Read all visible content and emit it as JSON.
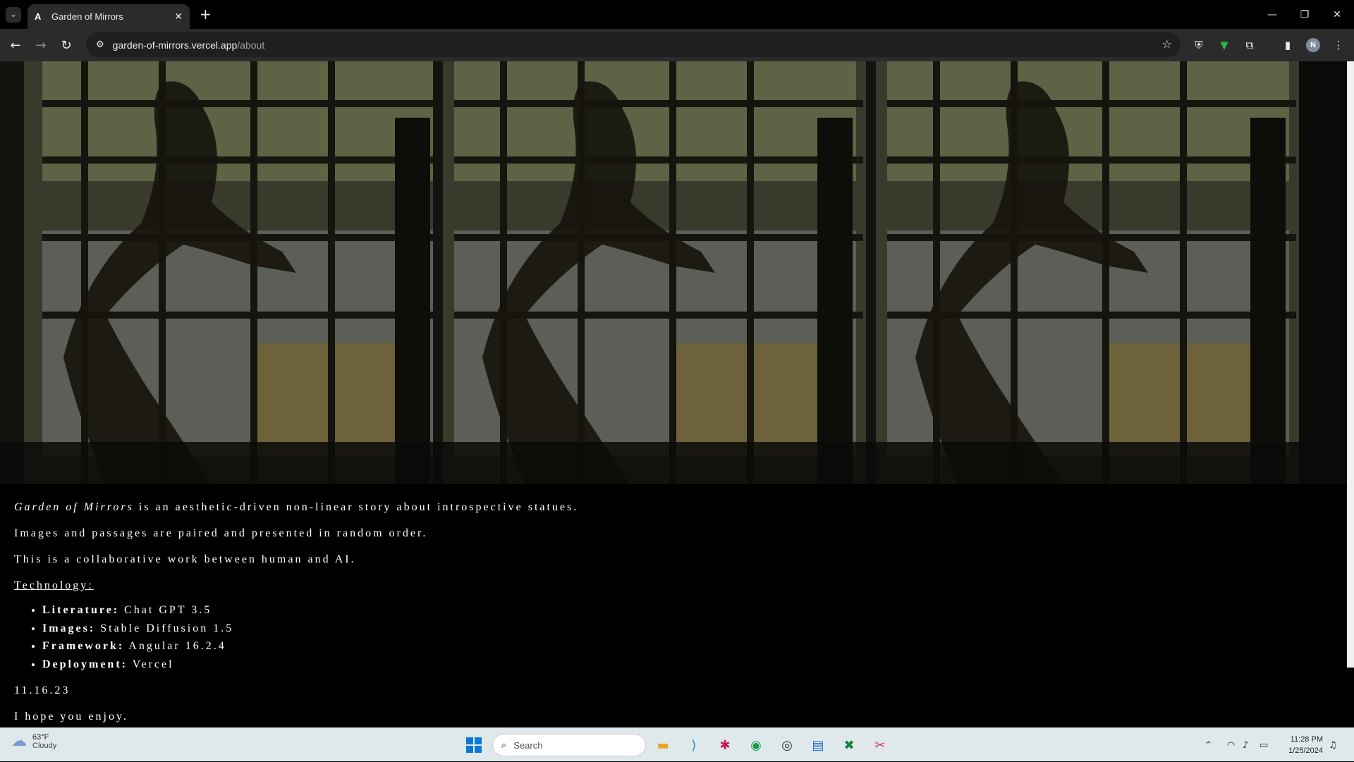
{
  "browser": {
    "tab_title": "Garden of Mirrors",
    "tab_favicon": "A",
    "url_host": "garden-of-mirrors.vercel.app",
    "url_path": "/about",
    "profile_initial": "N"
  },
  "about": {
    "title_italic": "Garden of Mirrors",
    "intro_rest": " is an aesthetic-driven non-linear story about introspective statues.",
    "line2": "Images and passages are paired and presented in random order.",
    "line3": "This is a collaborative work between human and AI.",
    "tech_heading": "Technology:",
    "tech_items": [
      {
        "label": "Literature:",
        "value": " Chat GPT 3.5"
      },
      {
        "label": "Images:",
        "value": " Stable Diffusion 1.5"
      },
      {
        "label": "Framework:",
        "value": " Angular 16.2.4"
      },
      {
        "label": "Deployment:",
        "value": " Vercel"
      }
    ],
    "date": "11.16.23",
    "closing": "I hope you enjoy."
  },
  "taskbar": {
    "weather_temp": "63°F",
    "weather_cond": "Cloudy",
    "search_placeholder": "Search",
    "time": "11:28 PM",
    "date": "1/25/2024"
  },
  "icons": {
    "weather": "cloud-icon",
    "start": "windows-start-icon",
    "apps": [
      "file-explorer-icon",
      "vscode-icon",
      "slack-icon",
      "chrome-icon",
      "terminal-icon",
      "notepad-icon",
      "excel-icon",
      "snipping-tool-icon"
    ]
  }
}
